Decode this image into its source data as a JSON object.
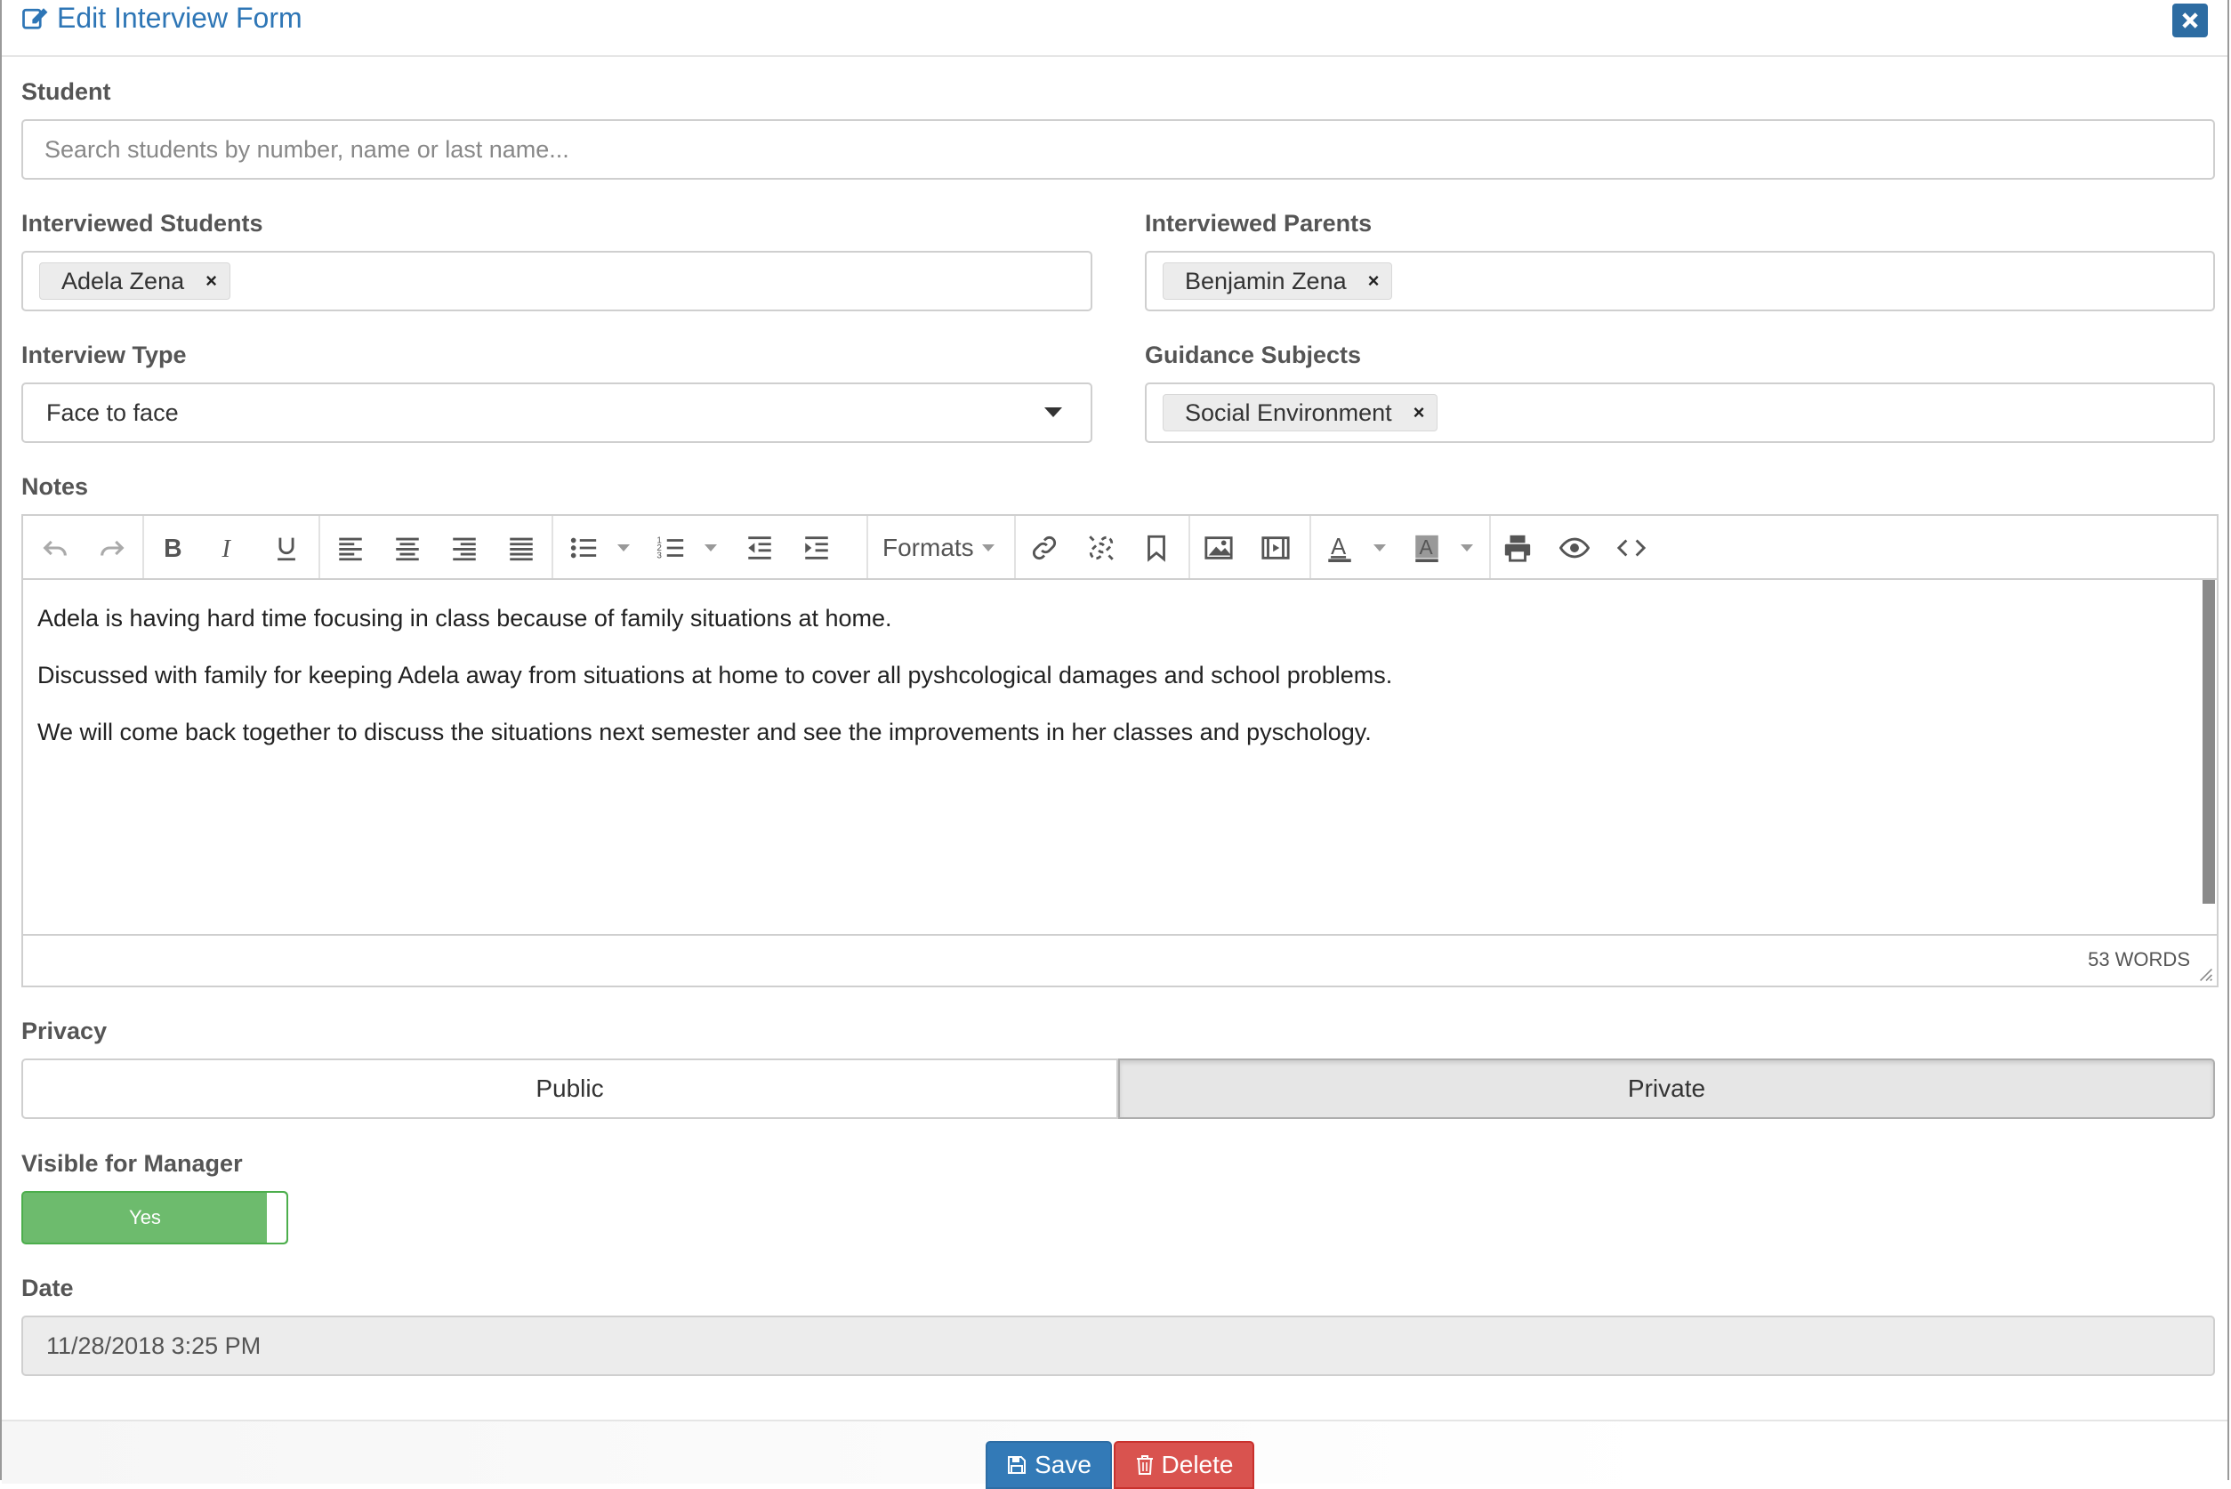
{
  "modal": {
    "title": "Edit Interview Form"
  },
  "student": {
    "label": "Student",
    "placeholder": "Search students by number, name or last name..."
  },
  "interviewed_students": {
    "label": "Interviewed Students",
    "tags": [
      "Adela Zena"
    ]
  },
  "interviewed_parents": {
    "label": "Interviewed Parents",
    "tags": [
      "Benjamin Zena"
    ]
  },
  "interview_type": {
    "label": "Interview Type",
    "value": "Face to face"
  },
  "guidance_subjects": {
    "label": "Guidance Subjects",
    "tags": [
      "Social Environment"
    ]
  },
  "notes": {
    "label": "Notes",
    "toolbar": {
      "formats": "Formats"
    },
    "paragraphs": [
      "Adela is having hard time focusing in class because of family situations at home.",
      "Discussed with family for keeping Adela away from situations at home to cover all pyshcological damages and school problems.",
      "We will come back together to discuss the situations next semester and see the improvements in her classes and pyschology."
    ],
    "word_count": "53 WORDS"
  },
  "privacy": {
    "label": "Privacy",
    "options": [
      "Public",
      "Private"
    ],
    "selected": "Private"
  },
  "visible_for_manager": {
    "label": "Visible for Manager",
    "value": "Yes"
  },
  "date": {
    "label": "Date",
    "value": "11/28/2018 3:25 PM"
  },
  "footer": {
    "save": "Save",
    "delete": "Delete"
  },
  "colors": {
    "primary": "#2e76b6",
    "success": "#6dbb6d",
    "danger": "#c9302c"
  }
}
